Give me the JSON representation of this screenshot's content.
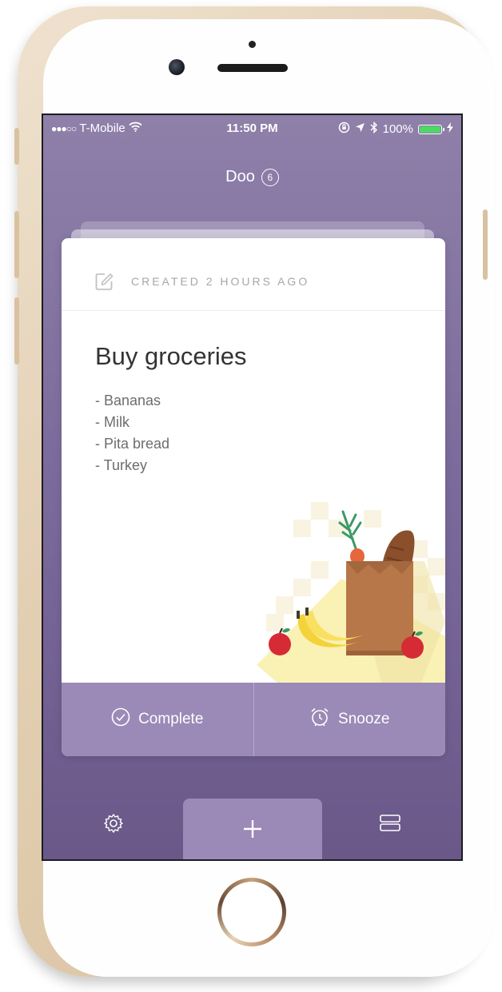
{
  "status_bar": {
    "signal_dots": "●●●○○",
    "carrier": "T-Mobile",
    "time": "11:50 PM",
    "battery": "100%",
    "icons": [
      "wifi-icon",
      "rotation-lock-icon",
      "location-arrow-icon",
      "bluetooth-icon",
      "battery-icon",
      "charging-icon"
    ]
  },
  "header": {
    "app_name": "Doo",
    "task_count": "6"
  },
  "card": {
    "created": "CREATED 2 HOURS AGO",
    "title": "Buy groceries",
    "items": [
      "- Bananas",
      "- Milk",
      "- Pita bread",
      "- Turkey"
    ]
  },
  "actions": {
    "complete": "Complete",
    "snooze": "Snooze"
  },
  "bottom_bar": {
    "add_icon": "+",
    "icons": [
      "gear-icon",
      "plus-icon",
      "list-icon"
    ]
  },
  "colors": {
    "screen_gradient_top": "#8e80a9",
    "screen_gradient_bottom": "#6a5889",
    "accent_purple": "#9b89b7",
    "battery_green": "#4cd964"
  }
}
